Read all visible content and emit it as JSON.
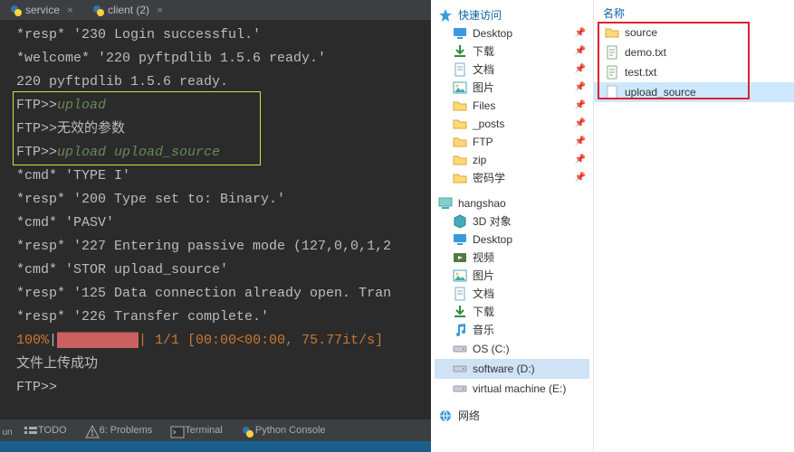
{
  "ide": {
    "tabs": [
      {
        "label": "service",
        "close": "×"
      },
      {
        "label": "client (2)",
        "close": "×"
      }
    ],
    "hl_box": true,
    "lines": [
      {
        "cls": "",
        "text": "*resp* '230 Login successful.'"
      },
      {
        "cls": "",
        "text": "*welcome* '220 pyftpdlib 1.5.6 ready.'"
      },
      {
        "cls": "",
        "text": "220 pyftpdlib 1.5.6 ready."
      },
      {
        "cls": "mix",
        "pre": "FTP>>",
        "post": "upload",
        "postCls": "green"
      },
      {
        "cls": "mix",
        "pre": "FTP>>",
        "post": "无效的参数",
        "postCls": "cn"
      },
      {
        "cls": "mix",
        "pre": "FTP>>",
        "post": "upload upload_source",
        "postCls": "green"
      },
      {
        "cls": "",
        "text": "*cmd* 'TYPE I'"
      },
      {
        "cls": "",
        "text": "*resp* '200 Type set to: Binary.'"
      },
      {
        "cls": "",
        "text": "*cmd* 'PASV'"
      },
      {
        "cls": "",
        "text": "*resp* '227 Entering passive mode (127,0,0,1,2"
      },
      {
        "cls": "",
        "text": "*cmd* 'STOR upload_source'"
      },
      {
        "cls": "",
        "text": "*resp* '125 Data connection already open. Tran"
      },
      {
        "cls": "",
        "text": "*resp* '226 Transfer complete.'"
      },
      {
        "cls": "progress",
        "pct": "100%",
        "bar": "██████████",
        "tail": "| 1/1 [00:00<00:00, 75.77it/s]"
      },
      {
        "cls": "",
        "text": "文件上传成功"
      },
      {
        "cls": "",
        "text": "FTP>>"
      }
    ],
    "toolstrip": {
      "run_label": "un",
      "items": [
        {
          "label": "TODO",
          "icon": "list"
        },
        {
          "label": "6: Problems",
          "icon": "warning"
        },
        {
          "label": "Terminal",
          "icon": "terminal"
        },
        {
          "label": "Python Console",
          "icon": "python"
        }
      ]
    }
  },
  "explorer": {
    "header_files": "名称",
    "quick_access_label": "快速访问",
    "quick_items": [
      {
        "label": "Desktop",
        "icon": "desktop",
        "pinned": true
      },
      {
        "label": "下载",
        "icon": "download",
        "pinned": true
      },
      {
        "label": "文档",
        "icon": "document",
        "pinned": true
      },
      {
        "label": "图片",
        "icon": "picture",
        "pinned": true
      },
      {
        "label": "Files",
        "icon": "folder",
        "pinned": true
      },
      {
        "label": "_posts",
        "icon": "folder",
        "pinned": true
      },
      {
        "label": "FTP",
        "icon": "folder",
        "pinned": true
      },
      {
        "label": "zip",
        "icon": "folder",
        "pinned": true
      },
      {
        "label": "密码学",
        "icon": "folder",
        "pinned": true
      }
    ],
    "user_label": "hangshao",
    "user_items": [
      {
        "label": "3D 对象",
        "icon": "3d"
      },
      {
        "label": "Desktop",
        "icon": "desktop"
      },
      {
        "label": "视频",
        "icon": "video"
      },
      {
        "label": "图片",
        "icon": "picture"
      },
      {
        "label": "文档",
        "icon": "document"
      },
      {
        "label": "下载",
        "icon": "download"
      },
      {
        "label": "音乐",
        "icon": "music"
      }
    ],
    "drives": [
      {
        "label": "OS (C:)",
        "icon": "drive"
      },
      {
        "label": "software (D:)",
        "icon": "drive",
        "selected": true
      },
      {
        "label": "virtual machine (E:)",
        "icon": "drive"
      }
    ],
    "network_label": "网络",
    "files": [
      {
        "label": "source",
        "icon": "folder"
      },
      {
        "label": "demo.txt",
        "icon": "txt"
      },
      {
        "label": "test.txt",
        "icon": "txt"
      },
      {
        "label": "upload_source",
        "icon": "file",
        "selected": true
      }
    ]
  },
  "colors": {
    "ide_bg": "#2b2b2b",
    "green": "#6a8759",
    "progress": "#cc5f5f",
    "hl_border": "#e0d84e",
    "red_rect": "#d23"
  }
}
